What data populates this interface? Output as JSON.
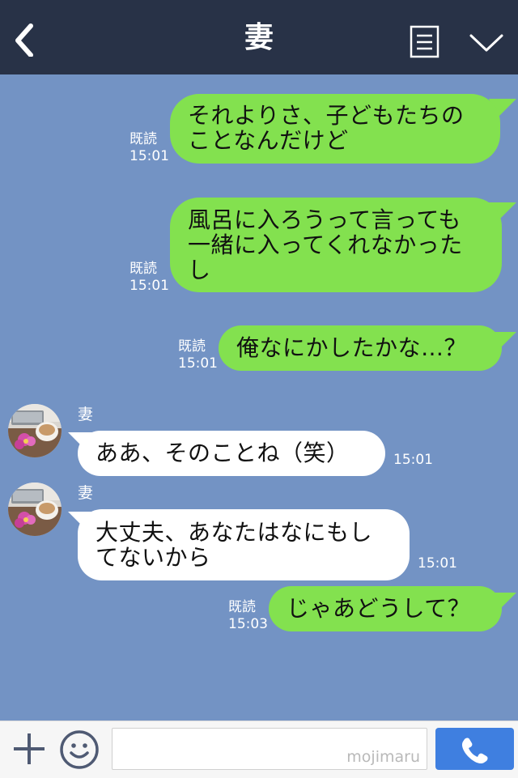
{
  "header": {
    "title": "妻"
  },
  "messages": [
    {
      "side": "right",
      "lines": [
        "それよりさ、子どもたちの",
        "ことなんだけど"
      ],
      "read": "既読",
      "time": "15:01"
    },
    {
      "side": "right",
      "lines": [
        "風呂に入ろうって言っても",
        "一緒に入ってくれなかった",
        "し"
      ],
      "read": "既読",
      "time": "15:01"
    },
    {
      "side": "right",
      "lines": [
        "俺なにかしたかな…？"
      ],
      "read": "既読",
      "time": "15:01"
    },
    {
      "side": "left",
      "sender": "妻",
      "lines": [
        "ああ、そのことね（笑）"
      ],
      "time": "15:01"
    },
    {
      "side": "left",
      "sender": "妻",
      "lines": [
        "大丈夫、あなたはなにもし",
        "てないから"
      ],
      "time": "15:01"
    },
    {
      "side": "right",
      "lines": [
        "じゃあどうして？"
      ],
      "read": "既読",
      "time": "15:03"
    }
  ],
  "footer": {
    "watermark": "mojimaru"
  },
  "icons": {
    "back": "chevron-left-icon",
    "note": "note-icon",
    "menu": "chevron-down-icon",
    "plus": "plus-icon",
    "emoji": "smiley-icon",
    "call": "phone-icon"
  },
  "colors": {
    "header": "#283247",
    "background": "#7393c4",
    "outgoing_bubble": "#83e14f",
    "incoming_bubble": "#ffffff",
    "call_button": "#3f7fe0"
  }
}
